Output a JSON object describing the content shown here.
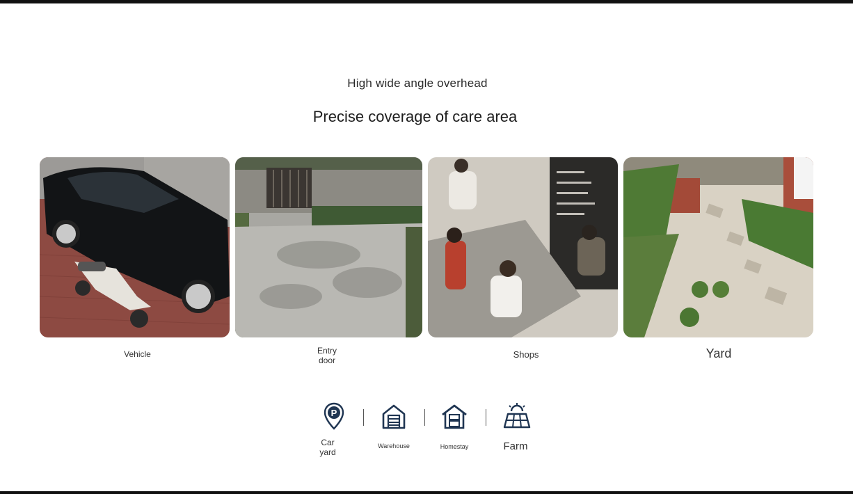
{
  "header": {
    "subtitle": "High wide angle overhead",
    "title": "Precise coverage of care area"
  },
  "scenes": [
    {
      "label": "Vehicle"
    },
    {
      "label_line1": "Entry",
      "label_line2": "door"
    },
    {
      "label": "Shops"
    },
    {
      "label": "Yard"
    }
  ],
  "places": [
    {
      "icon": "parking-pin-icon",
      "label_line1": "Car",
      "label_line2": "yard"
    },
    {
      "icon": "warehouse-icon",
      "label": "Warehouse"
    },
    {
      "icon": "homestay-icon",
      "label": "Homestay"
    },
    {
      "icon": "solar-farm-icon",
      "label": "Farm"
    }
  ],
  "colors": {
    "icon": "#1f3552",
    "text": "#222222",
    "frame": "#111111"
  }
}
